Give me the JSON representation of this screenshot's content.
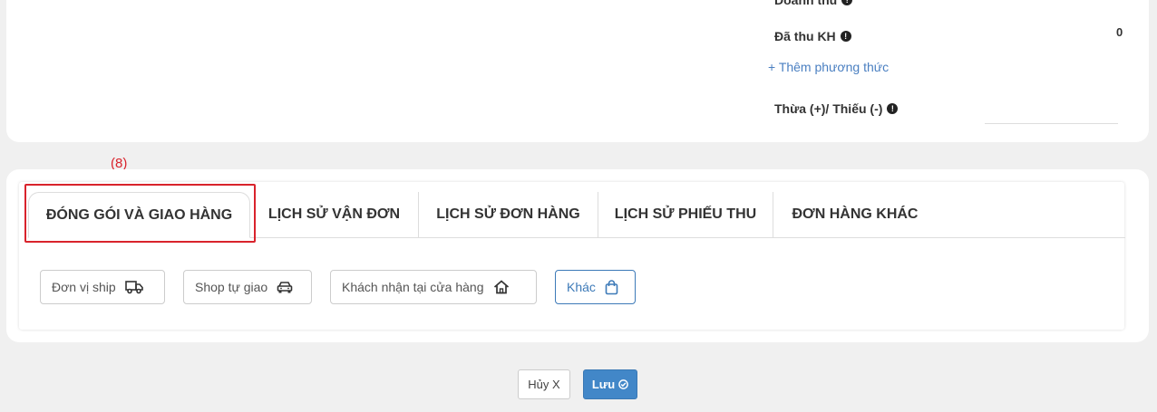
{
  "summary": {
    "revenue_label": "Doanh thu",
    "paid_label": "Đã thu KH",
    "paid_value": "0",
    "add_method": "+ Thêm phương thức",
    "diff_label": "Thừa (+)/ Thiếu (-)"
  },
  "annotation": {
    "marker": "(8)"
  },
  "tabs": [
    {
      "label": "ĐÓNG GÓI VÀ GIAO HÀNG",
      "active": true
    },
    {
      "label": "LỊCH SỬ VẬN ĐƠN"
    },
    {
      "label": "LỊCH SỬ ĐƠN HÀNG"
    },
    {
      "label": "LỊCH SỬ PHIẾU THU"
    },
    {
      "label": "ĐƠN HÀNG KHÁC"
    }
  ],
  "delivery_options": [
    {
      "label": "Đơn vị ship",
      "icon": "truck-icon"
    },
    {
      "label": "Shop tự giao",
      "icon": "car-icon"
    },
    {
      "label": "Khách nhận tại cửa hàng",
      "icon": "home-icon"
    },
    {
      "label": "Khác",
      "icon": "shopping-bag-icon",
      "selected": true
    }
  ],
  "actions": {
    "cancel_label": "Hủy X",
    "save_label": "Lưu"
  },
  "colors": {
    "accent": "#4287c8",
    "annotation_red": "#d9232c",
    "link": "#4a7fc1"
  }
}
